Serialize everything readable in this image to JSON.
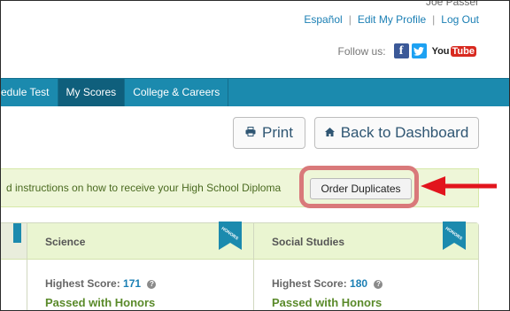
{
  "header": {
    "user_name": "Joe Passer",
    "links": [
      "Español",
      "Edit My Profile",
      "Log Out"
    ],
    "link_separator": "|",
    "follow_label": "Follow us:",
    "social": {
      "facebook": "f",
      "twitter": "t",
      "youtube_you": "You",
      "youtube_tube": "Tube"
    }
  },
  "nav": {
    "items": [
      "edule Test",
      "My Scores",
      "College & Careers"
    ],
    "active_index": 1,
    "color": "#1b8aae"
  },
  "toolbar": {
    "print_label": "Print",
    "print_icon": "print-icon",
    "back_label": "Back to Dashboard",
    "back_icon": "home-icon"
  },
  "notice": {
    "text": "d instructions on how to receive your High School Diploma",
    "order_button": "Order Duplicates"
  },
  "annotation": {
    "highlight_color": "#d9797a",
    "arrow_color": "#e2151d"
  },
  "cards": [
    {
      "title": "Science",
      "badge": "HONORS",
      "score_label": "Highest Score:",
      "score": "171",
      "status": "Passed with Honors"
    },
    {
      "title": "Social Studies",
      "badge": "HONORS",
      "score_label": "Highest Score:",
      "score": "180",
      "status": "Passed with Honors"
    }
  ]
}
